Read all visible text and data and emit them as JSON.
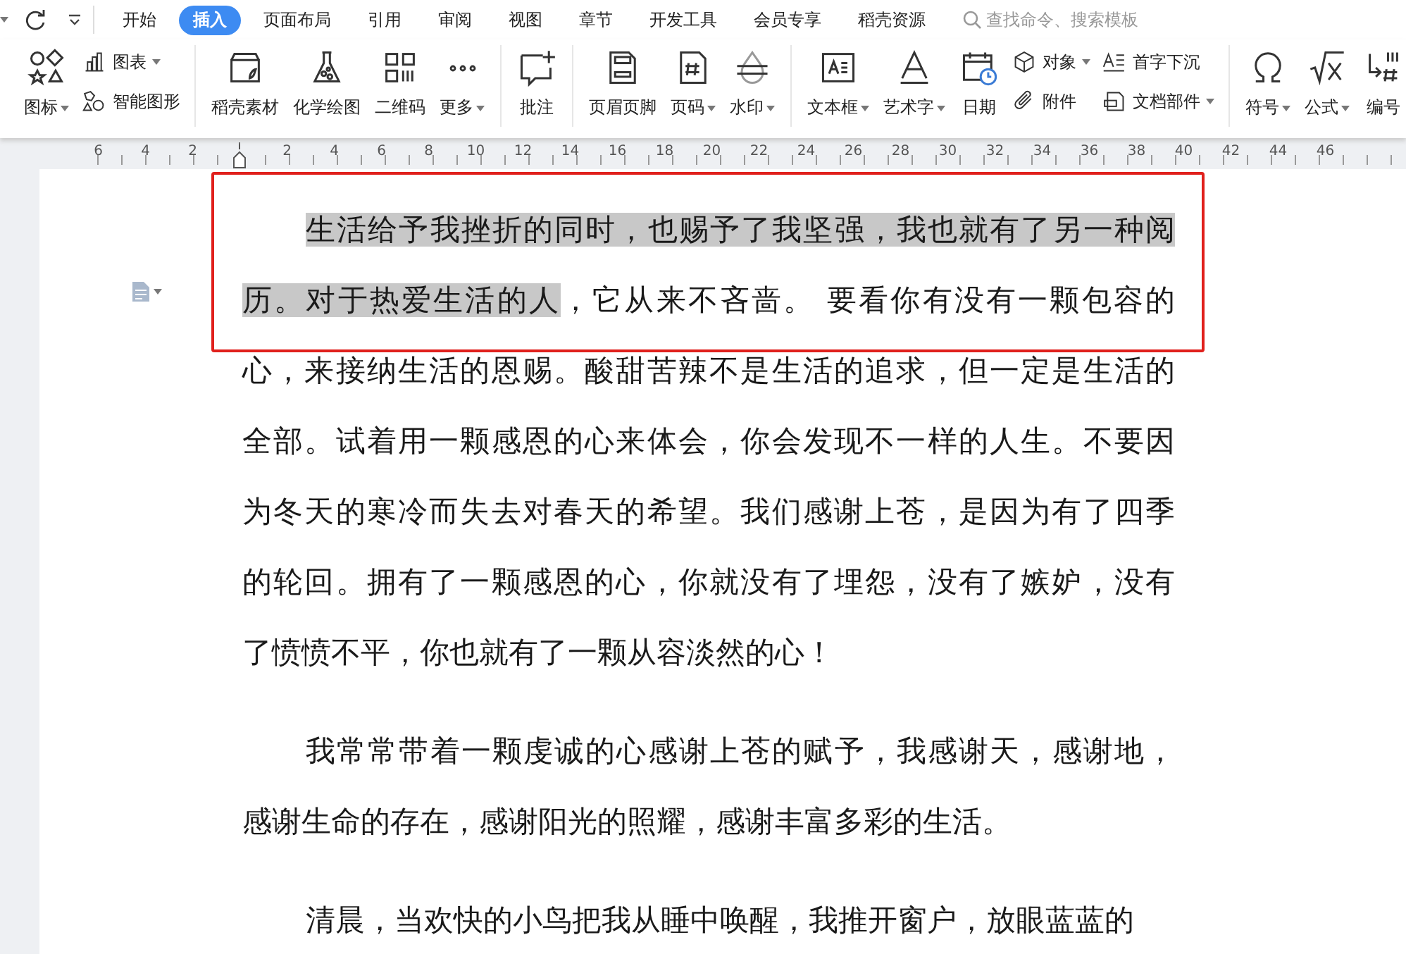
{
  "tabs": [
    {
      "label": "开始",
      "selected": false
    },
    {
      "label": "插入",
      "selected": true
    },
    {
      "label": "页面布局",
      "selected": false
    },
    {
      "label": "引用",
      "selected": false
    },
    {
      "label": "审阅",
      "selected": false
    },
    {
      "label": "视图",
      "selected": false
    },
    {
      "label": "章节",
      "selected": false
    },
    {
      "label": "开发工具",
      "selected": false
    },
    {
      "label": "会员专享",
      "selected": false
    },
    {
      "label": "稻壳资源",
      "selected": false
    }
  ],
  "search": {
    "placeholder": "查找命令、搜索模板"
  },
  "ribbon": [
    {
      "items": [
        {
          "kind": "large",
          "label": "图标",
          "dropdown": true
        },
        {
          "kind": "stack",
          "rows": [
            {
              "label": "图表",
              "dropdown": true
            },
            {
              "label": "智能图形",
              "dropdown": false
            }
          ]
        }
      ]
    },
    {
      "items": [
        {
          "kind": "large",
          "label": "稻壳素材",
          "dropdown": false
        },
        {
          "kind": "large",
          "label": "化学绘图",
          "dropdown": false
        },
        {
          "kind": "large",
          "label": "二维码",
          "dropdown": false
        },
        {
          "kind": "large",
          "label": "更多",
          "dropdown": true
        }
      ]
    },
    {
      "items": [
        {
          "kind": "large",
          "label": "批注",
          "dropdown": false
        }
      ]
    },
    {
      "items": [
        {
          "kind": "large",
          "label": "页眉页脚",
          "dropdown": false
        },
        {
          "kind": "large",
          "label": "页码",
          "dropdown": true
        },
        {
          "kind": "large",
          "label": "水印",
          "dropdown": true
        }
      ]
    },
    {
      "items": [
        {
          "kind": "large",
          "label": "文本框",
          "dropdown": true
        },
        {
          "kind": "large",
          "label": "艺术字",
          "dropdown": true
        },
        {
          "kind": "large",
          "label": "日期",
          "dropdown": false
        },
        {
          "kind": "stack",
          "rows": [
            {
              "label": "对象",
              "dropdown": true
            },
            {
              "label": "附件",
              "dropdown": false
            }
          ]
        },
        {
          "kind": "stack",
          "rows": [
            {
              "label": "首字下沉",
              "dropdown": false
            },
            {
              "label": "文档部件",
              "dropdown": true
            }
          ]
        }
      ]
    },
    {
      "items": [
        {
          "kind": "large",
          "label": "符号",
          "dropdown": true
        },
        {
          "kind": "large",
          "label": "公式",
          "dropdown": true
        },
        {
          "kind": "large",
          "label": "编号",
          "dropdown": false
        }
      ]
    }
  ],
  "ruler": {
    "left_labels": [
      "6",
      "4",
      "2"
    ],
    "right_labels": [
      "2",
      "4",
      "6",
      "8",
      "10",
      "12",
      "14",
      "16",
      "18",
      "20",
      "22",
      "24",
      "26",
      "28",
      "30",
      "32",
      "34",
      "36",
      "38",
      "40",
      "42",
      "44",
      "46"
    ]
  },
  "document": {
    "paragraphs": [
      {
        "lines": [
          [
            {
              "text": "生活给予我挫折的同时，也赐予了我坚强，我也就有了另一种阅",
              "selected": true
            }
          ],
          [
            {
              "text": "历。对于热爱生活的人",
              "selected": true
            },
            {
              "text": "，它从来不吝啬。 要看你有没有一颗包容的",
              "selected": false
            }
          ],
          [
            {
              "text": "心，来接纳生活的恩赐。酸甜苦辣不是生活的追求，但一定是生活的",
              "selected": false
            }
          ],
          [
            {
              "text": "全部。试着用一颗感恩的心来体会，你会发现不一样的人生。不要因",
              "selected": false
            }
          ],
          [
            {
              "text": "为冬天的寒冷而失去对春天的希望。我们感谢上苍，是因为有了四季",
              "selected": false
            }
          ],
          [
            {
              "text": "的轮回。拥有了一颗感恩的心，你就没有了埋怨，没有了嫉妒，没有",
              "selected": false
            }
          ],
          [
            {
              "text": "了愤愤不平，你也就有了一颗从容淡然的心！",
              "selected": false
            }
          ]
        ]
      },
      {
        "lines": [
          [
            {
              "text": "我常常带着一颗虔诚的心感谢上苍的赋予，我感谢天，感谢地，",
              "selected": false
            }
          ],
          [
            {
              "text": "感谢生命的存在，感谢阳光的照耀，感谢丰富多彩的生活。",
              "selected": false
            }
          ]
        ]
      },
      {
        "lines": [
          [
            {
              "text": "清晨，当欢快的小鸟把我从睡中唤醒，我推开窗户，放眼蓝蓝的",
              "selected": false
            }
          ]
        ]
      }
    ]
  }
}
